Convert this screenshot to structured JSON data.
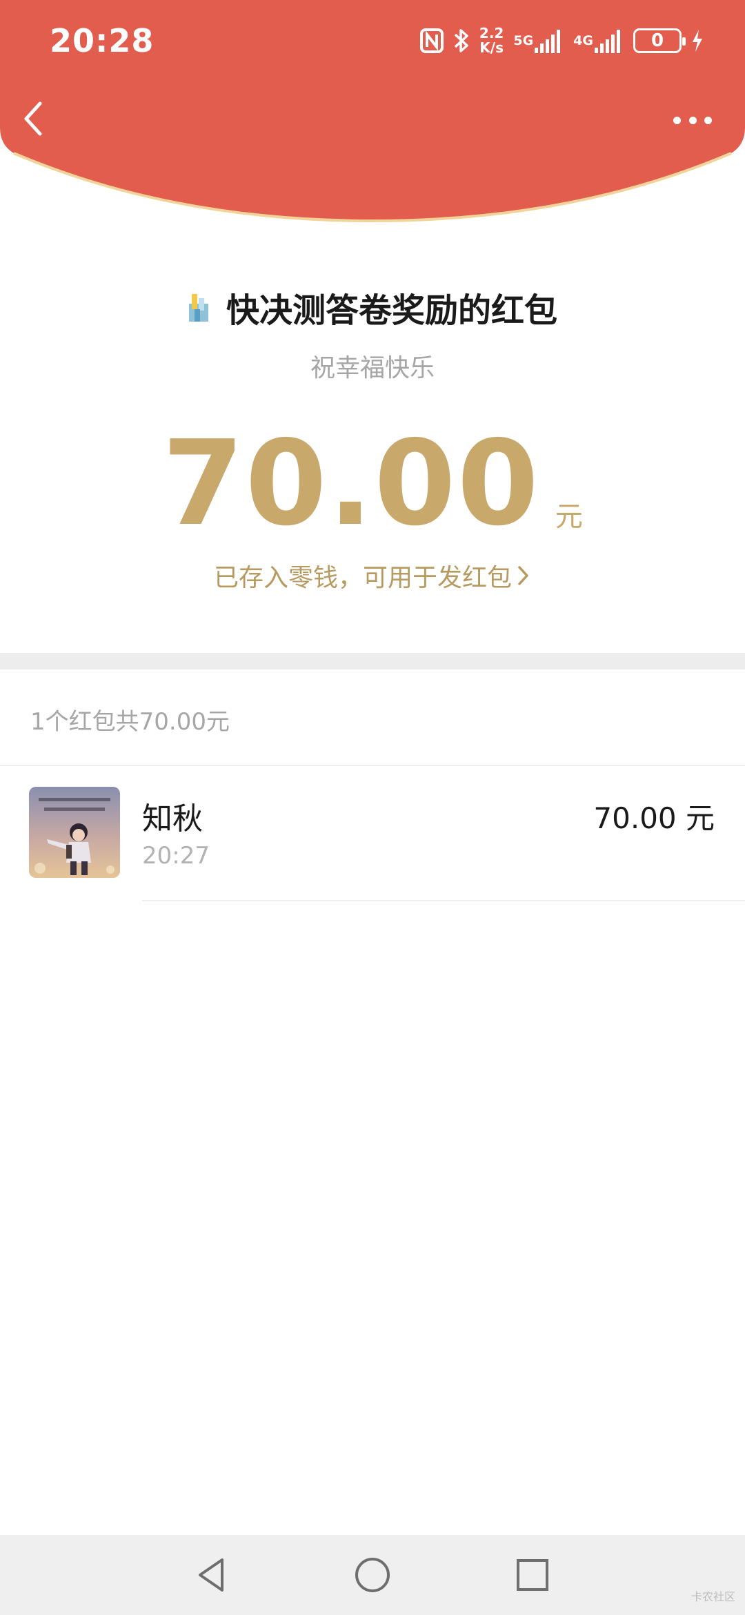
{
  "status_bar": {
    "time": "20:28",
    "net_speed_top": "2.2",
    "net_speed_bottom": "K/s",
    "sim1_label": "5G",
    "sim2_label": "4G",
    "battery_level": "0"
  },
  "header": {
    "color": "#e35d4e",
    "border_color": "#f2d49a"
  },
  "red_packet": {
    "title": "快决测答卷奖励的红包",
    "blessing": "祝幸福快乐",
    "amount": "70.00",
    "unit": "元",
    "stored_text": "已存入零钱，可用于发红包",
    "accent_color": "#c8a86b"
  },
  "summary": {
    "count_text": "1个红包共70.00元"
  },
  "records": [
    {
      "name": "知秋",
      "time": "20:27",
      "amount": "70.00 元",
      "avatar_icon": "anime-boy-avatar"
    }
  ],
  "system_nav": {
    "back_icon": "triangle-back-icon",
    "home_icon": "circle-home-icon",
    "recents_icon": "square-recents-icon"
  },
  "watermark": "卡农社区"
}
